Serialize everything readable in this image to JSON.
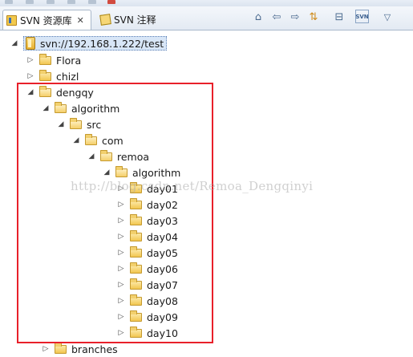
{
  "tabs": [
    {
      "label": "SVN 资源库",
      "close": "✕",
      "active": true
    },
    {
      "label": "SVN 注释",
      "active": false
    }
  ],
  "toolbar": {
    "icons": [
      "home-icon",
      "back-arrow-icon",
      "forward-arrow-icon",
      "sync-icon",
      "collapse-all-icon",
      "svn-repo-icon",
      "view-menu-icon"
    ],
    "glyphs": {
      "home": "⌂",
      "back": "⇦",
      "forward": "⇨",
      "sync": "⇅",
      "collapse": "⊟",
      "svn": "SVN",
      "menu": "▽"
    }
  },
  "tree": {
    "repository": "svn://192.168.1.222/test",
    "items": [
      {
        "label": "Flora",
        "expanded": false
      },
      {
        "label": "chizl",
        "expanded": false
      },
      {
        "label": "dengqy",
        "expanded": true
      },
      {
        "label": "algorithm",
        "expanded": true
      },
      {
        "label": "src",
        "expanded": true
      },
      {
        "label": "com",
        "expanded": true
      },
      {
        "label": "remoa",
        "expanded": true
      },
      {
        "label": "algorithm",
        "expanded": true
      },
      {
        "label": "day01",
        "expanded": false
      },
      {
        "label": "day02",
        "expanded": false
      },
      {
        "label": "day03",
        "expanded": false
      },
      {
        "label": "day04",
        "expanded": false
      },
      {
        "label": "day05",
        "expanded": false
      },
      {
        "label": "day06",
        "expanded": false
      },
      {
        "label": "day07",
        "expanded": false
      },
      {
        "label": "day08",
        "expanded": false
      },
      {
        "label": "day09",
        "expanded": false
      },
      {
        "label": "day10",
        "expanded": false
      },
      {
        "label": "branches",
        "expanded": false
      }
    ],
    "arrows": {
      "expanded": "◢",
      "collapsed": "▷"
    }
  },
  "watermark": "http://blog.csdn.net/Remoa_Dengqinyi",
  "colors": {
    "highlight_border": "#e8202a",
    "selection_bg": "#d8e6f7"
  }
}
